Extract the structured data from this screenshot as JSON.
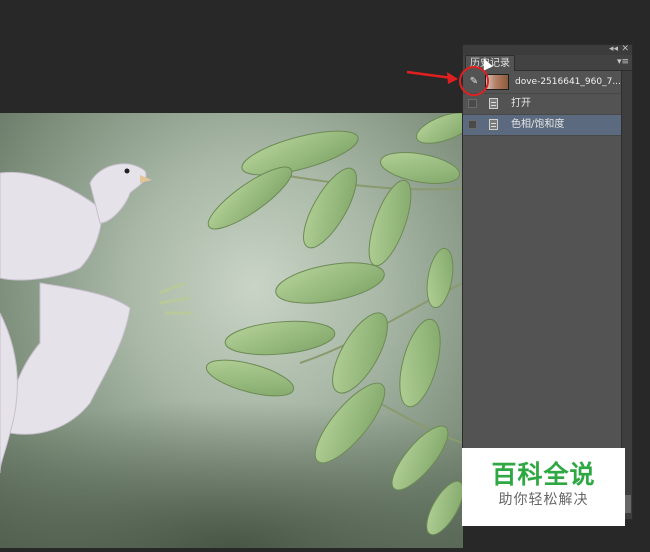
{
  "panel": {
    "title": "历史记录",
    "collapse_glyph": "◂◂",
    "close_glyph": "✕",
    "menu_glyph": "▾≡",
    "snapshot": {
      "icon": "history-brush-icon",
      "label": "dove-2516641_960_7..."
    },
    "steps": [
      {
        "label": "打开",
        "icon": "document-icon",
        "selected": false
      },
      {
        "label": "色相/饱和度",
        "icon": "document-icon",
        "selected": true
      }
    ]
  },
  "colors": {
    "app_background": "#282828",
    "panel_background": "#535353",
    "selected_row": "#5b6a7e",
    "annotation": "#e02020",
    "watermark_green": "#2fa742"
  },
  "watermark": {
    "title": "百科全说",
    "subtitle": "助你轻松解决"
  }
}
